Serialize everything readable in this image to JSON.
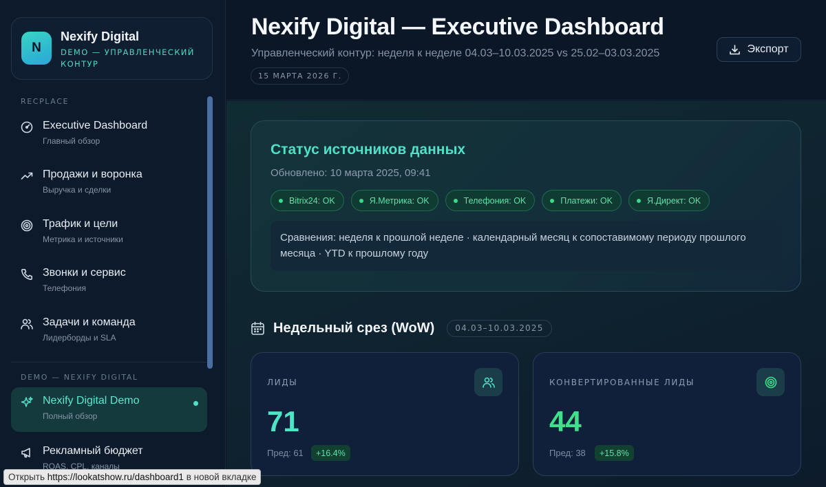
{
  "brand": {
    "logo_letter": "N",
    "name": "Nexify Digital",
    "subtitle": "DEMO — УПРАВЛЕНЧЕСКИЙ КОНТУР"
  },
  "sidebar": {
    "section_main": "RECPLACE",
    "section_demo": "DEMO — NEXIFY DIGITAL",
    "items": [
      {
        "title": "Executive Dashboard",
        "sub": "Главный обзор",
        "icon": "gauge-icon"
      },
      {
        "title": "Продажи и воронка",
        "sub": "Выручка и сделки",
        "icon": "trend-up-icon"
      },
      {
        "title": "Трафик и цели",
        "sub": "Метрика и источники",
        "icon": "target-icon"
      },
      {
        "title": "Звонки и сервис",
        "sub": "Телефония",
        "icon": "phone-icon"
      },
      {
        "title": "Задачи и команда",
        "sub": "Лидерборды и SLA",
        "icon": "users-icon"
      },
      {
        "title": "Nexify Digital Demo",
        "sub": "Полный обзор",
        "icon": "sparkles-icon",
        "active": true
      },
      {
        "title": "Рекламный бюджет",
        "sub": "ROAS, CPL, каналы",
        "icon": "megaphone-icon"
      }
    ]
  },
  "header": {
    "title": "Nexify Digital — Executive Dashboard",
    "subtitle": "Управленческий контур: неделя к неделе 04.03–10.03.2025 vs 25.02–03.03.2025",
    "date": "15 МАРТА 2026 Г.",
    "export_label": "Экспорт"
  },
  "status": {
    "title": "Статус источников данных",
    "updated": "Обновлено: 10 марта 2025, 09:41",
    "sources": [
      "Bitrix24: OK",
      "Я.Метрика: OK",
      "Телефония: OK",
      "Платежи: OK",
      "Я.Директ: OK"
    ],
    "note": "Сравнения: неделя к прошлой неделе · календарный месяц к сопоставимому периоду прошлого месяца · YTD к прошлому году"
  },
  "weekly": {
    "title": "Недельный срез (WoW)",
    "range": "04.03–10.03.2025",
    "kpis": [
      {
        "label": "ЛИДЫ",
        "value": "71",
        "prev": "Пред: 61",
        "delta": "+16.4%",
        "color": "#4fe3c8",
        "icon": "users-icon"
      },
      {
        "label": "КОНВЕРТИРОВАННЫЕ ЛИДЫ",
        "value": "44",
        "prev": "Пред: 38",
        "delta": "+15.8%",
        "color": "#3ee08b",
        "icon": "target-icon"
      }
    ]
  },
  "link_status": {
    "prefix": "Открыть",
    "url": "https://lookatshow.ru/dashboard1",
    "suffix": "в новой вкладке"
  },
  "colors": {
    "accent": "#4fe0c8",
    "success": "#5fe1a7",
    "background": "#0b1626"
  }
}
